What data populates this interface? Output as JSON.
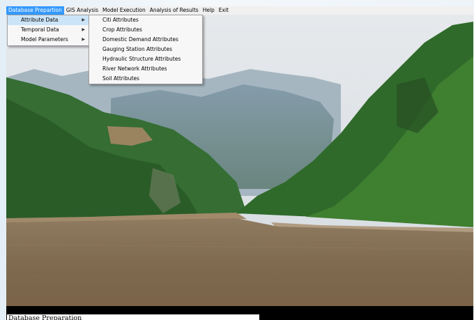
{
  "menubar": {
    "items": [
      {
        "label": "Database Prepartion",
        "active": true
      },
      {
        "label": "GIS Analysis",
        "active": false
      },
      {
        "label": "Model Execution",
        "active": false
      },
      {
        "label": "Analysis of Results",
        "active": false
      },
      {
        "label": "Help",
        "active": false
      },
      {
        "label": "Exit",
        "active": false
      }
    ]
  },
  "database_menu": {
    "items": [
      {
        "label": "Attribute Data",
        "submenu": true,
        "highlighted": true
      },
      {
        "label": "Temporal Data",
        "submenu": true,
        "highlighted": false
      },
      {
        "label": "Model Parameters",
        "submenu": true,
        "highlighted": false
      }
    ],
    "submenu_arrow": "▶"
  },
  "attribute_menu": {
    "items": [
      {
        "label": "Citi Attributes"
      },
      {
        "label": "Crop Attributes"
      },
      {
        "label": "Domestic Demand Attributes"
      },
      {
        "label": "Gauging Station Attributes"
      },
      {
        "label": "Hydraulic Structure Attributes"
      },
      {
        "label": "River Network Attributes"
      },
      {
        "label": "Soil Attributes"
      }
    ]
  },
  "status_bar": {
    "text": "Database Preparation"
  },
  "colors": {
    "menu_highlight": "#3399ff",
    "item_highlight": "#cce4f7",
    "river": "#8a7558",
    "mountain_green": "#2f6a2a",
    "sky": "#e2e6e9"
  }
}
